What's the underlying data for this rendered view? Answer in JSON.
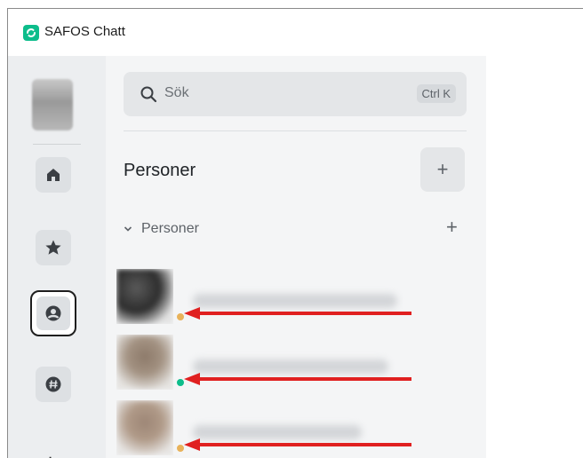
{
  "window": {
    "title": "SAFOS Chatt"
  },
  "search": {
    "placeholder": "Sök",
    "shortcut": "Ctrl K"
  },
  "section": {
    "title": "Personer",
    "add_label": "+"
  },
  "group": {
    "label": "Personer",
    "add_label": "+"
  },
  "rail": {
    "add_label": "+"
  },
  "people": [
    {
      "status": "away",
      "status_color": "#e8b25a"
    },
    {
      "status": "online",
      "status_color": "#0dbd8b"
    },
    {
      "status": "away",
      "status_color": "#e8b25a"
    }
  ],
  "colors": {
    "accent": "#0dbd8b",
    "arrow": "#e02020"
  }
}
